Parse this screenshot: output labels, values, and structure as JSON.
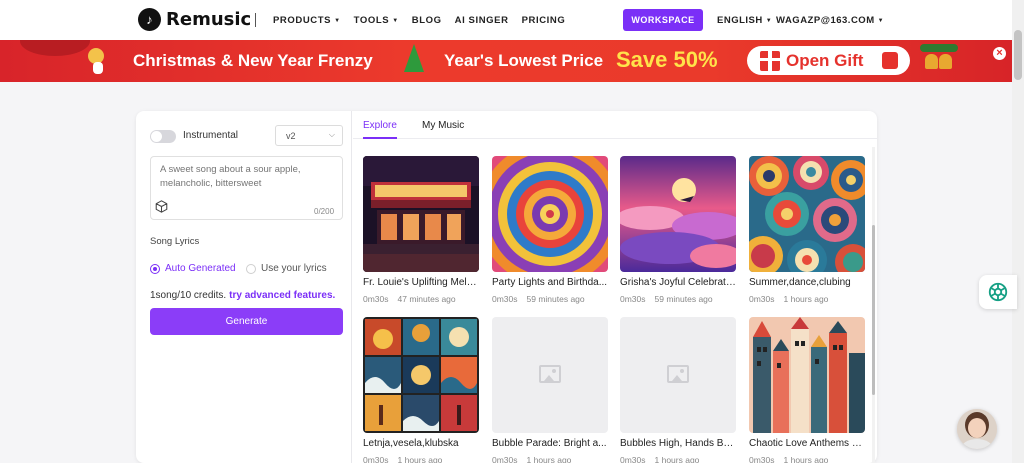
{
  "header": {
    "logo_text": "Remusic",
    "nav": [
      {
        "label": "PRODUCTS",
        "has_caret": true
      },
      {
        "label": "TOOLS",
        "has_caret": true
      },
      {
        "label": "BLOG",
        "has_caret": false
      },
      {
        "label": "AI SINGER",
        "has_caret": false
      },
      {
        "label": "PRICING",
        "has_caret": false
      }
    ],
    "workspace_label": "WORKSPACE",
    "language": "ENGLISH",
    "account": "WAGAZP@163.COM"
  },
  "banner": {
    "text_left": "Christmas & New Year Frenzy",
    "text_mid": "Year's Lowest Price",
    "text_save": "Save 50%",
    "button_label": "Open Gift",
    "close_label": "×"
  },
  "form": {
    "instrumental_label": "Instrumental",
    "instrumental_on": false,
    "version_value": "v2",
    "prompt_placeholder": "A sweet song about a sour apple, melancholic, bittersweet",
    "char_count": "0/200",
    "song_lyrics_label": "Song Lyrics",
    "radio_auto": "Auto Generated",
    "radio_own": "Use your lyrics",
    "credits_text": "1song/10 credits.",
    "credits_link": "try advanced features.",
    "generate_label": "Generate"
  },
  "tabs": [
    {
      "label": "Explore",
      "active": true
    },
    {
      "label": "My Music",
      "active": false
    }
  ],
  "tracks": [
    {
      "title": "Fr. Louie's Uplifting Melo...",
      "duration": "0m30s",
      "time": "47 minutes ago",
      "art": "theater"
    },
    {
      "title": "Party Lights and Birthda...",
      "duration": "0m30s",
      "time": "59 minutes ago",
      "art": "swirl"
    },
    {
      "title": "Grisha's Joyful Celebrati...",
      "duration": "0m30s",
      "time": "59 minutes ago",
      "art": "sky"
    },
    {
      "title": "Summer,dance,clubing",
      "duration": "0m30s",
      "time": "1 hours ago",
      "art": "pattern"
    },
    {
      "title": "Letnja,vesela,klubska",
      "duration": "0m30s",
      "time": "1 hours ago",
      "art": "tiles"
    },
    {
      "title": "Bubble Parade: Bright a...",
      "duration": "0m30s",
      "time": "1 hours ago",
      "art": "placeholder"
    },
    {
      "title": "Bubbles High, Hands Bri...",
      "duration": "0m30s",
      "time": "1 hours ago",
      "art": "placeholder"
    },
    {
      "title": "Chaotic Love Anthems U...",
      "duration": "0m30s",
      "time": "1 hours ago",
      "art": "city"
    }
  ],
  "colors": {
    "accent": "#7b2ff7",
    "banner_red": "#e5322d",
    "banner_yellow": "#ffe34a"
  }
}
